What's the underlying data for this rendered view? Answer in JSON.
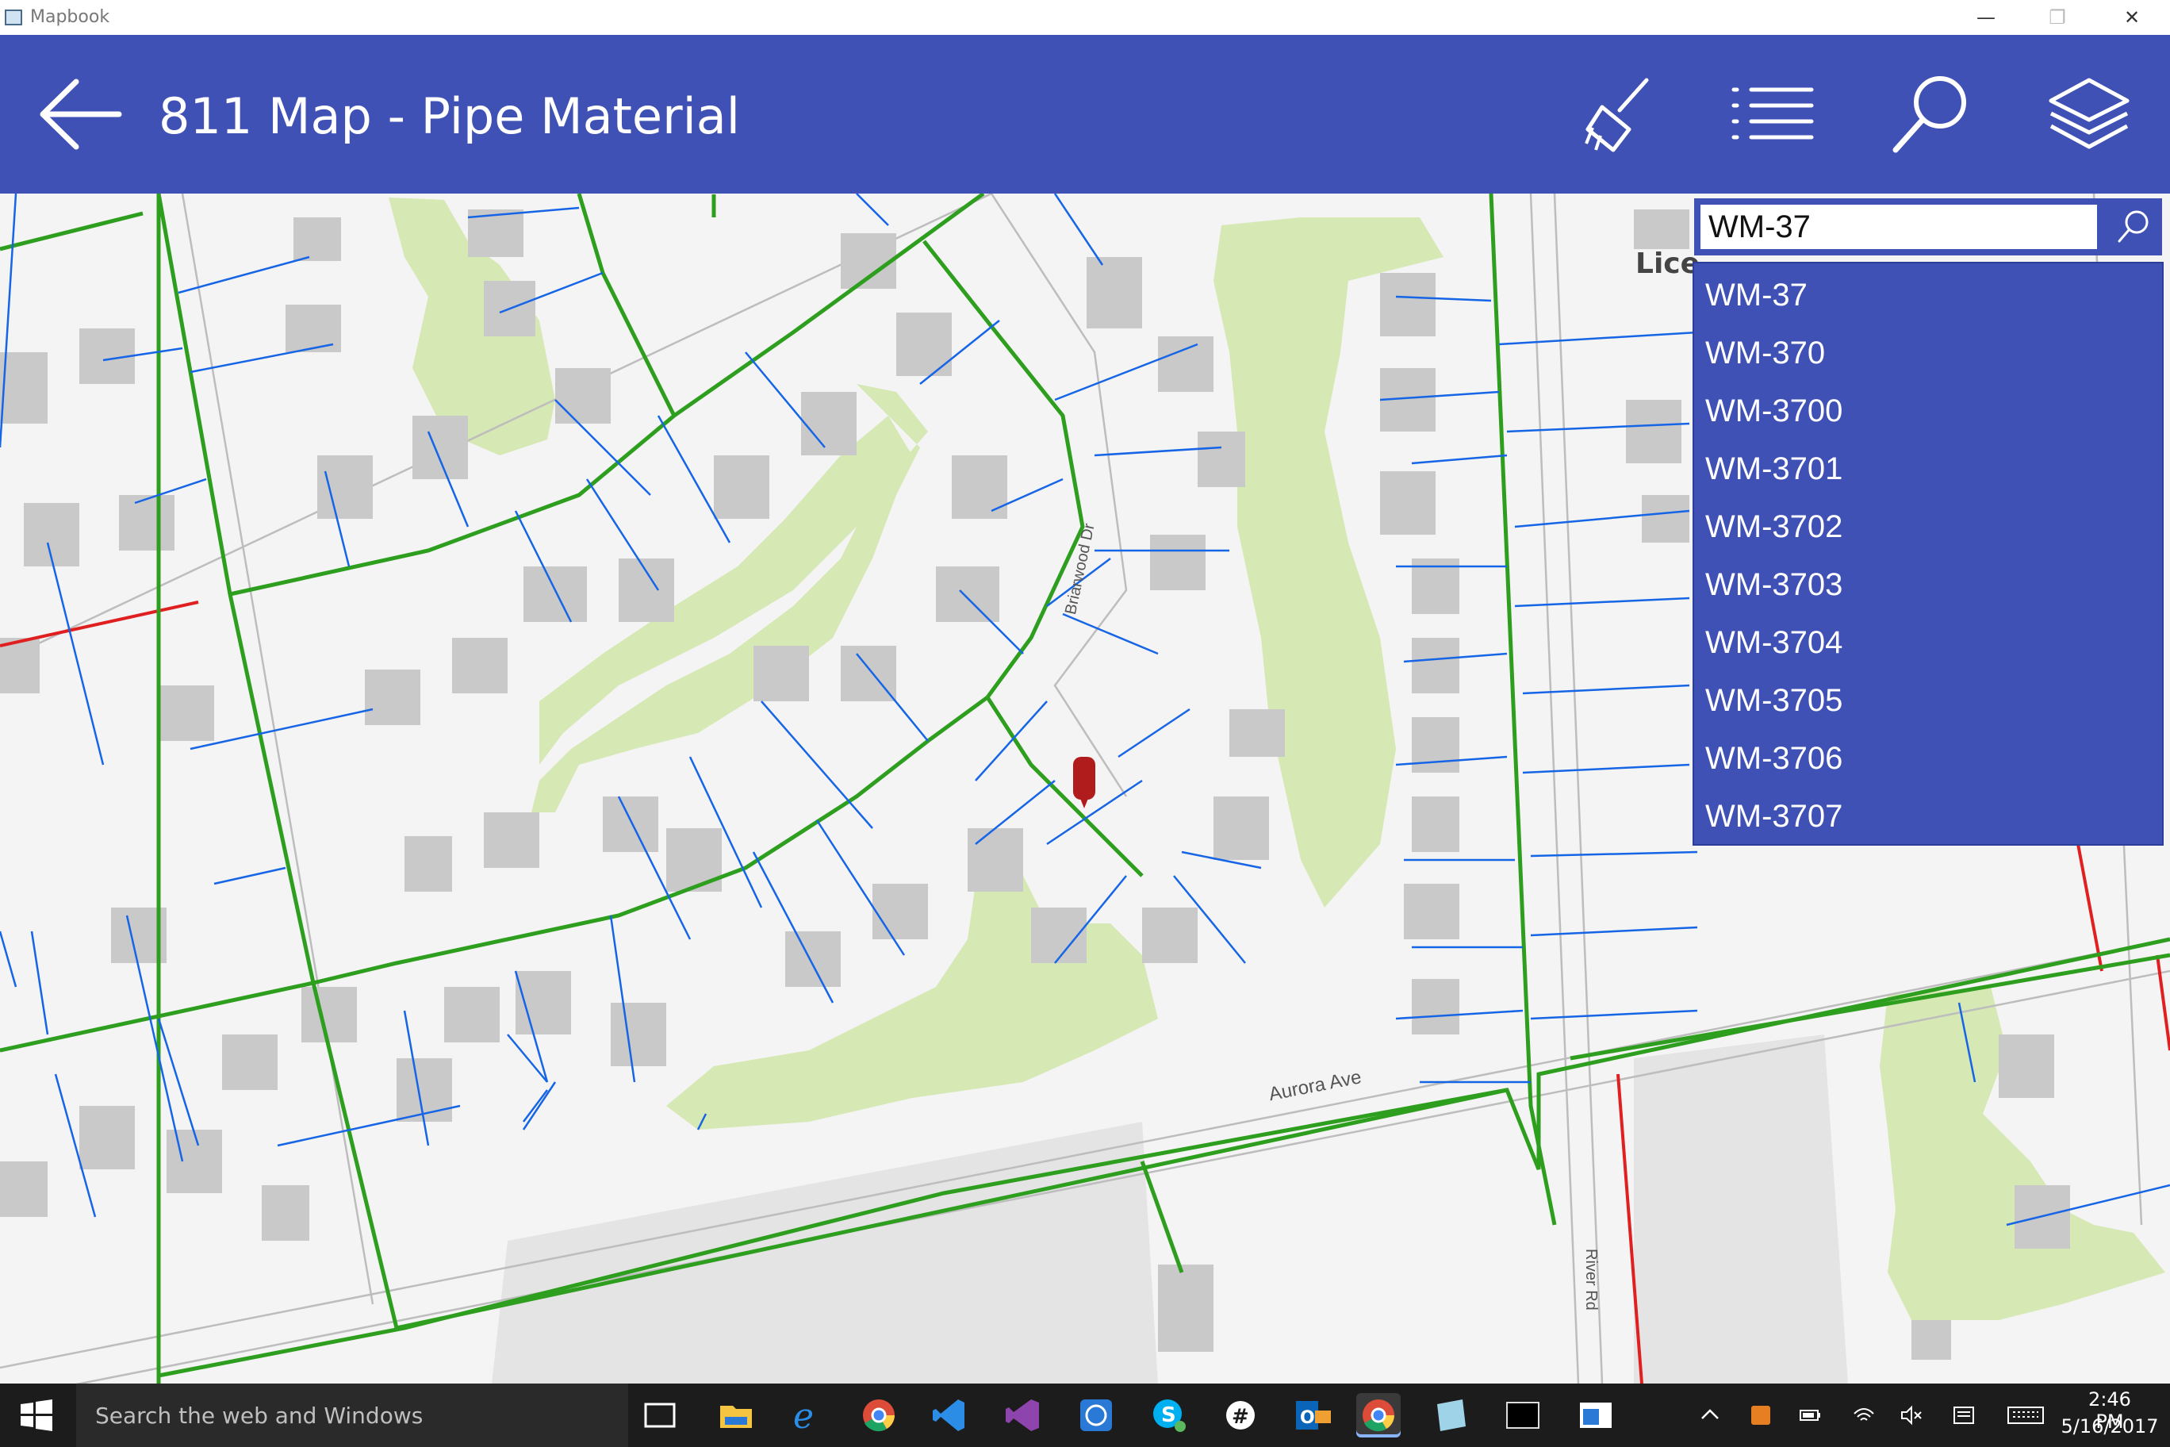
{
  "window": {
    "title": "Mapbook",
    "minimize": "—",
    "maximize": "❐",
    "close": "✕"
  },
  "header": {
    "title": "811 Map - Pipe Material"
  },
  "toolbar": {
    "back": "back-arrow-icon",
    "clear": "broom-icon",
    "legend": "list-icon",
    "search": "search-icon",
    "layers": "layers-icon"
  },
  "search": {
    "value": "WM-37",
    "suggestions": [
      "WM-37",
      "WM-370",
      "WM-3700",
      "WM-3701",
      "WM-3702",
      "WM-3703",
      "WM-3704",
      "WM-3705",
      "WM-3706",
      "WM-3707"
    ]
  },
  "map": {
    "street_labels": [
      "Aurora Ave",
      "Briarwood Dr",
      "River Rd"
    ],
    "partial_label": "Lice",
    "colors": {
      "main_pipe": "#2e9e1e",
      "service_line": "#1565e6",
      "alt_pipe": "#e02020",
      "green_space": "#d6e8b4",
      "building": "#c9c9c9",
      "marker": "#b01c1c"
    }
  },
  "taskbar": {
    "search_placeholder": "Search the web and Windows",
    "time": "2:46 PM",
    "date": "5/16/2017",
    "apps": [
      "task-view-icon",
      "file-explorer-icon",
      "edge-icon",
      "chrome-icon",
      "vscode-icon",
      "visual-studio-icon",
      "app-globe-icon",
      "skype-icon",
      "slack-icon",
      "outlook-icon",
      "chrome-active-icon",
      "app-notes-icon",
      "terminal-icon",
      "app-window-icon"
    ]
  },
  "theme": {
    "header": "#3f51b5",
    "taskbar": "#1c1c1c"
  }
}
